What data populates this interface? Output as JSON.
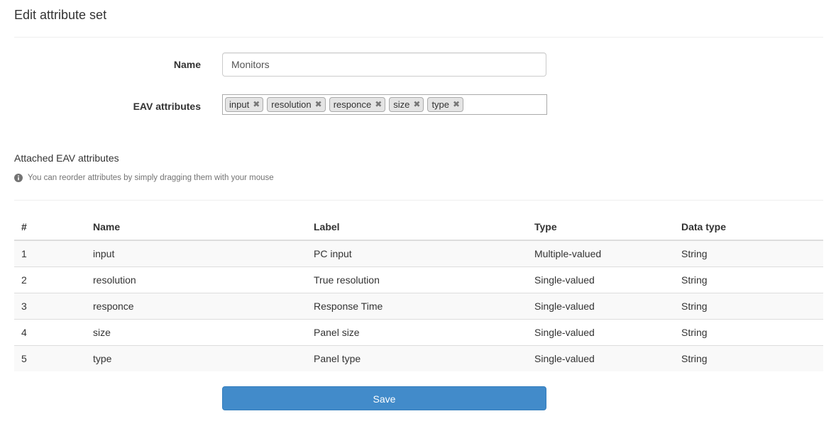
{
  "page": {
    "title": "Edit attribute set"
  },
  "form": {
    "name_label": "Name",
    "name_value": "Monitors",
    "eav_label": "EAV attributes",
    "tags": [
      {
        "label": "input",
        "remove": "✖"
      },
      {
        "label": "resolution",
        "remove": "✖"
      },
      {
        "label": "responce",
        "remove": "✖"
      },
      {
        "label": "size",
        "remove": "✖"
      },
      {
        "label": "type",
        "remove": "✖"
      }
    ]
  },
  "attached": {
    "title": "Attached EAV attributes",
    "hint": "You can reorder attributes by simply dragging them with your mouse",
    "hint_icon": "info-circle-icon"
  },
  "table": {
    "headers": [
      "#",
      "Name",
      "Label",
      "Type",
      "Data type"
    ],
    "rows": [
      [
        "1",
        "input",
        "PC input",
        "Multiple-valued",
        "String"
      ],
      [
        "2",
        "resolution",
        "True resolution",
        "Single-valued",
        "String"
      ],
      [
        "3",
        "responce",
        "Response Time",
        "Single-valued",
        "String"
      ],
      [
        "4",
        "size",
        "Panel size",
        "Single-valued",
        "String"
      ],
      [
        "5",
        "type",
        "Panel type",
        "Single-valued",
        "String"
      ]
    ]
  },
  "actions": {
    "save_label": "Save"
  },
  "colors": {
    "primary": "#428bca",
    "stripe": "#f9f9f9",
    "border": "#dddddd"
  }
}
